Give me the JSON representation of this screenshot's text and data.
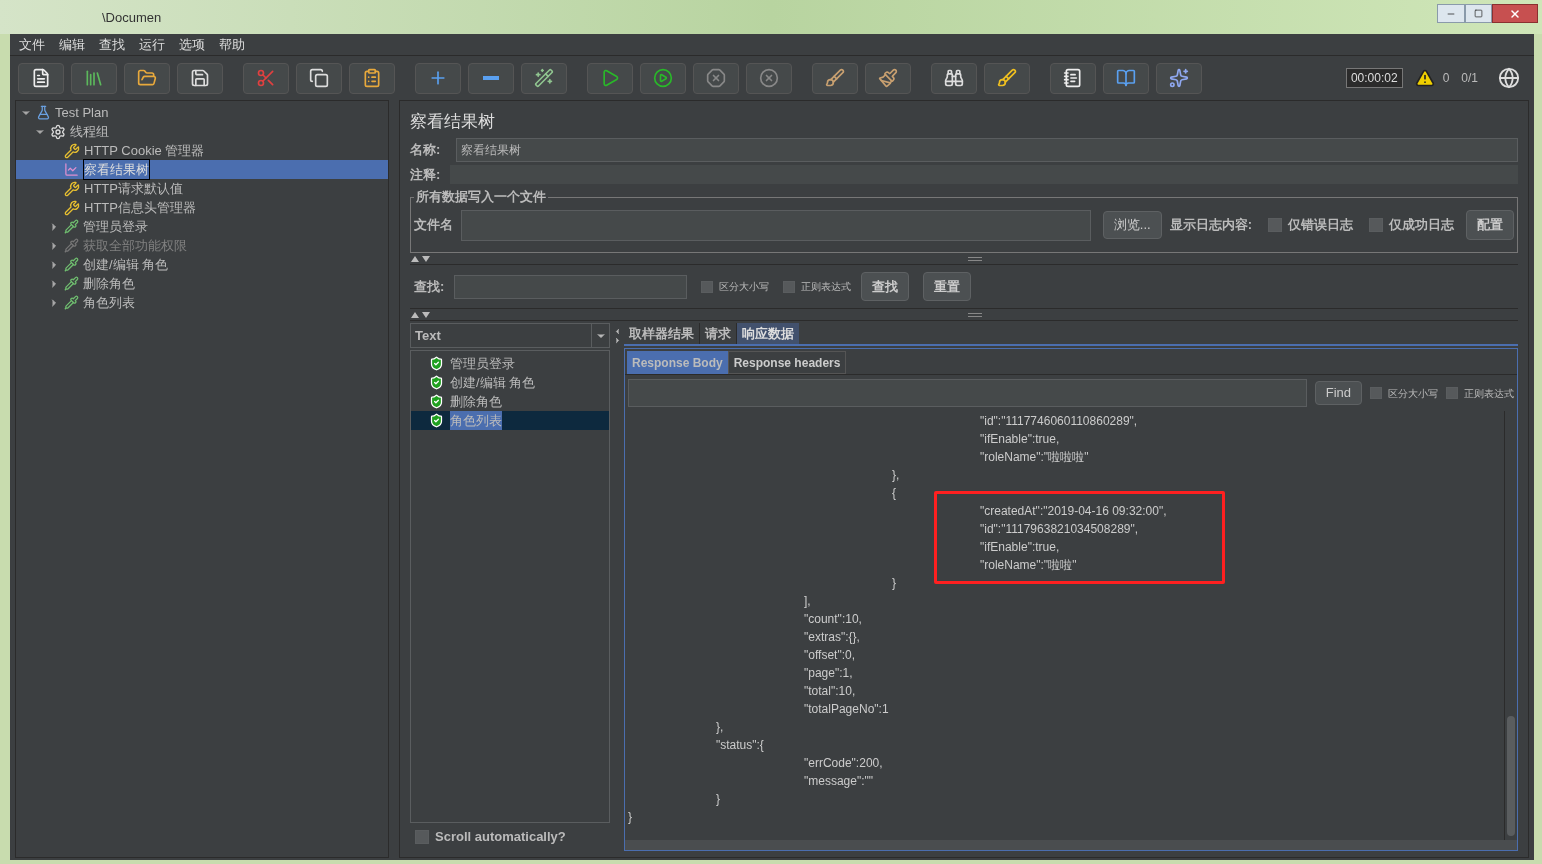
{
  "window": {
    "title": "\\Documen"
  },
  "menu": [
    "文件",
    "编辑",
    "查找",
    "运行",
    "选项",
    "帮助"
  ],
  "status": {
    "timer": "00:00:02",
    "warnings": "0",
    "threads": "0/1"
  },
  "tree": [
    {
      "label": "Test Plan",
      "kind": "plan",
      "expanded": true,
      "selected": false,
      "disabled": false,
      "children": [
        {
          "label": "线程组",
          "kind": "group",
          "expanded": true,
          "selected": false,
          "disabled": false,
          "children": [
            {
              "label": "HTTP Cookie 管理器",
              "kind": "config",
              "selected": false,
              "disabled": false
            },
            {
              "label": "察看结果树",
              "kind": "listener",
              "selected": true,
              "disabled": false
            },
            {
              "label": "HTTP请求默认值",
              "kind": "config",
              "selected": false,
              "disabled": false
            },
            {
              "label": "HTTP信息头管理器",
              "kind": "config",
              "selected": false,
              "disabled": false
            },
            {
              "label": "管理员登录",
              "kind": "sampler",
              "expanded": false,
              "selected": false,
              "disabled": false
            },
            {
              "label": "获取全部功能权限",
              "kind": "sampler",
              "expanded": false,
              "selected": false,
              "disabled": true
            },
            {
              "label": "创建/编辑 角色",
              "kind": "sampler",
              "expanded": false,
              "selected": false,
              "disabled": false
            },
            {
              "label": "删除角色",
              "kind": "sampler",
              "expanded": false,
              "selected": false,
              "disabled": false
            },
            {
              "label": "角色列表",
              "kind": "sampler",
              "expanded": false,
              "selected": false,
              "disabled": false
            }
          ]
        }
      ]
    }
  ],
  "panel": {
    "title": "察看结果树",
    "name_label": "名称:",
    "name_value": "察看结果树",
    "comment_label": "注释:",
    "file_group": {
      "legend": "所有数据写入一个文件",
      "file_label": "文件名",
      "browse": "浏览...",
      "log_label": "显示日志内容:",
      "options": [
        {
          "label": "仅错误日志",
          "checked": false
        },
        {
          "label": "仅成功日志",
          "checked": false
        }
      ],
      "configure": "配置"
    },
    "search": {
      "label": "查找:",
      "options": [
        {
          "label": "区分大小写",
          "checked": false
        },
        {
          "label": "正则表达式",
          "checked": false
        }
      ],
      "find": "查找",
      "reset": "重置"
    },
    "renderer": "Text",
    "results": [
      {
        "label": "管理员登录",
        "selected": false
      },
      {
        "label": "创建/编辑 角色",
        "selected": false
      },
      {
        "label": "删除角色",
        "selected": false
      },
      {
        "label": "角色列表",
        "selected": true
      }
    ],
    "scroll_auto": {
      "label": "Scroll automatically?",
      "checked": false
    },
    "tabs": [
      {
        "label": "取样器结果",
        "selected": false
      },
      {
        "label": "请求",
        "selected": false
      },
      {
        "label": "响应数据",
        "selected": true
      }
    ],
    "subtabs": [
      {
        "label": "Response Body",
        "selected": true
      },
      {
        "label": "Response headers",
        "selected": false
      }
    ],
    "body_find": {
      "button": "Find",
      "options": [
        {
          "label": "区分大小写",
          "checked": false
        },
        {
          "label": "正则表达式",
          "checked": false
        }
      ]
    },
    "body_lines": [
      "\t\t\t\t\"id\":\"1117746060110860289\",",
      "\t\t\t\t\"ifEnable\":true,",
      "\t\t\t\t\"roleName\":\"啦啦啦\"",
      "\t\t\t},",
      "\t\t\t{",
      "\t\t\t\t\"createdAt\":\"2019-04-16 09:32:00\",",
      "\t\t\t\t\"id\":\"1117963821034508289\",",
      "\t\t\t\t\"ifEnable\":true,",
      "\t\t\t\t\"roleName\":\"啦啦\"",
      "\t\t\t}",
      "\t\t],",
      "\t\t\"count\":10,",
      "\t\t\"extras\":{},",
      "\t\t\"offset\":0,",
      "\t\t\"page\":1,",
      "\t\t\"total\":10,",
      "\t\t\"totalPageNo\":1",
      "\t},",
      "\t\"status\":{",
      "\t\t\"errCode\":200,",
      "\t\t\"message\":\"\"",
      "\t}",
      "}"
    ]
  }
}
